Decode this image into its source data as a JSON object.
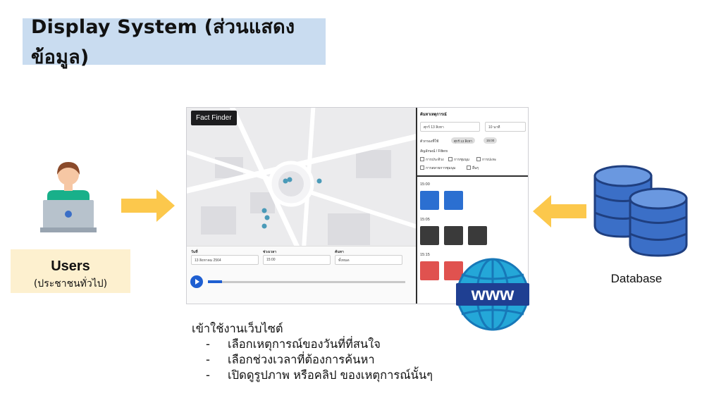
{
  "title": "Display System (ส่วนแสดงข้อมูล)",
  "users": {
    "label": "Users",
    "sublabel": "(ประชาชนทั่วไป)"
  },
  "database": {
    "label": "Database"
  },
  "screenshot": {
    "map_button": "Fact Finder",
    "bottom_panel": {
      "date_label": "วันที่",
      "date_value": "13 สิงหาคม 2564",
      "time_label": "ช่วงเวลา",
      "time_value": "15:00",
      "event_label": "ค้นหา",
      "event_value": "ทั้งหมด"
    },
    "side_panel": {
      "heading": "ค้นหาเหตุการณ์",
      "date_value": "ศุกร์ 13 สิงหา",
      "duration_value": "10 นาที",
      "chips_label": "ตัวกรองที่ใช้",
      "chips": [
        "ศุกร์ 13 สิงหา",
        "15:00"
      ],
      "filters_label": "สัญลักษณ์ / Filters",
      "checkboxes": [
        "การประท้วง",
        "การชุมนุม",
        "การปะทะ",
        "การสลายการชุมนุม",
        "อื่นๆ"
      ],
      "time_slots": [
        "15:00",
        "15:05",
        "15:15"
      ]
    }
  },
  "caption": {
    "heading": "เข้าใช้งานเว็บไซต์",
    "items": [
      "เลือกเหตุการณ์ของวันที่ที่สนใจ",
      "เลือกช่วงเวลาที่ต้องการค้นหา",
      "เปิดดูรูปภาพ หรือคลิป ของเหตุการณ์นั้นๆ"
    ]
  },
  "colors": {
    "title_bg": "#c9dcf0",
    "users_bg": "#fdf0cf",
    "arrow": "#fcc84c",
    "database": "#3b6fc7",
    "www_globe": "#24a7d8",
    "tile_blue": "#2b6fd1",
    "tile_dark": "#3a3a3a",
    "tile_red": "#e0524f"
  }
}
